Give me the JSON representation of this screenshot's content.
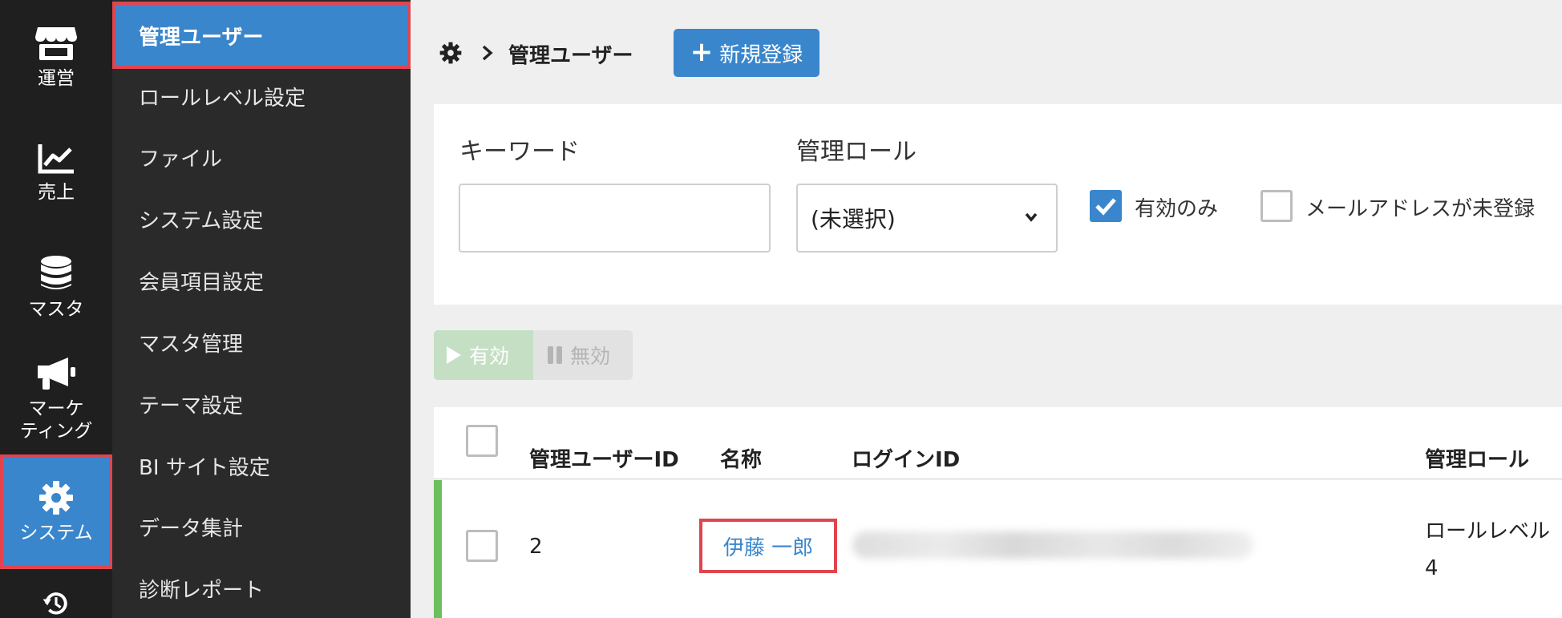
{
  "rail": {
    "items": [
      {
        "label": "運営",
        "icon": "store-icon"
      },
      {
        "label": "売上",
        "icon": "chart-line-icon"
      },
      {
        "label": "マスタ",
        "icon": "database-icon"
      },
      {
        "label": "マーケ\nティング",
        "icon": "megaphone-icon"
      },
      {
        "label": "システム",
        "icon": "gear-icon",
        "active": true
      },
      {
        "label": "",
        "icon": "history-icon"
      }
    ]
  },
  "submenu": {
    "items": [
      {
        "label": "管理ユーザー",
        "active": true
      },
      {
        "label": "ロールレベル設定"
      },
      {
        "label": "ファイル"
      },
      {
        "label": "システム設定"
      },
      {
        "label": "会員項目設定"
      },
      {
        "label": "マスタ管理"
      },
      {
        "label": "テーマ設定"
      },
      {
        "label": "BI サイト設定"
      },
      {
        "label": "データ集計"
      },
      {
        "label": "診断レポート"
      }
    ]
  },
  "header": {
    "breadcrumb_title": "管理ユーザー",
    "new_button_label": "新規登録"
  },
  "filter": {
    "keyword_label": "キーワード",
    "keyword_value": "",
    "role_label": "管理ロール",
    "role_selected": "(未選択)",
    "active_only_label": "有効のみ",
    "active_only_checked": true,
    "no_email_label": "メールアドレスが未登録"
  },
  "bulk": {
    "enable_label": "有効",
    "disable_label": "無効"
  },
  "table": {
    "headers": {
      "id": "管理ユーザーID",
      "name": "名称",
      "login_id": "ログインID",
      "role": "管理ロール"
    },
    "rows": [
      {
        "id": "2",
        "name": "伊藤 一郎",
        "login_id": "",
        "role": "ロールレベル4",
        "status_color": "#6cbe5e"
      }
    ]
  },
  "colors": {
    "accent": "#3a86cc",
    "highlight": "#e0454f",
    "rail_bg": "#1f1f1f",
    "submenu_bg": "#2a2a2a"
  }
}
